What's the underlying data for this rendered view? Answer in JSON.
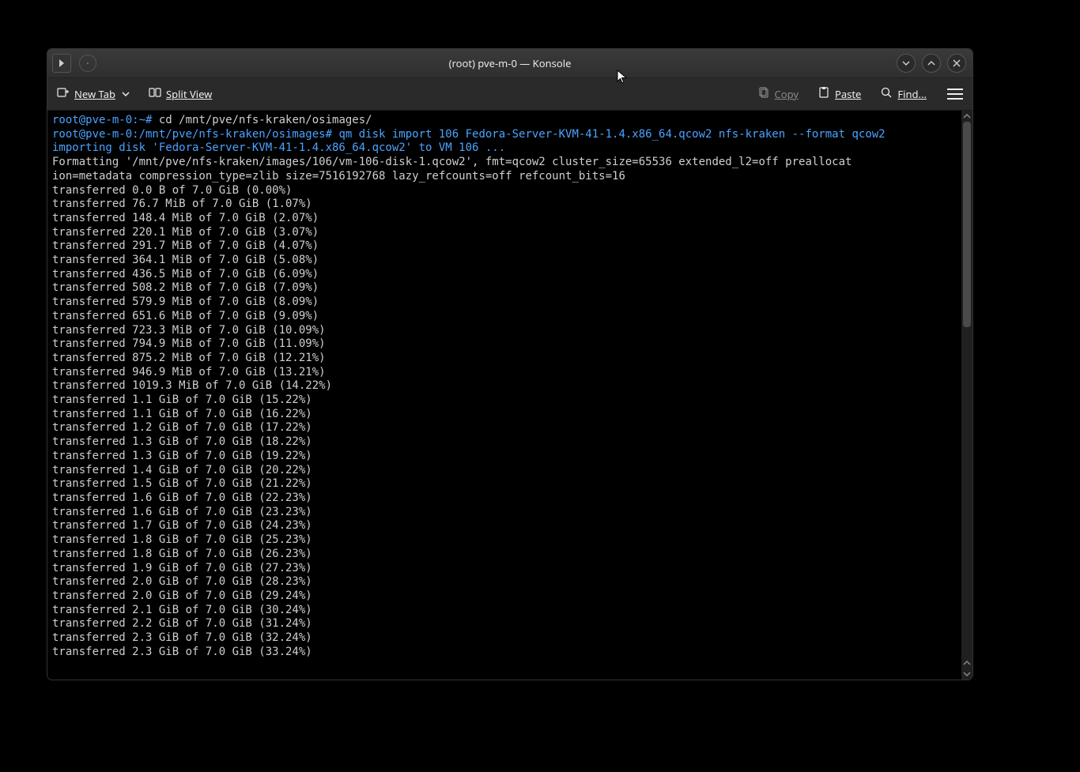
{
  "window": {
    "title": "(root) pve-m-0 — Konsole"
  },
  "toolbar": {
    "new_tab": "New Tab",
    "split_view": "Split View",
    "copy": "Copy",
    "paste": "Paste",
    "find": "Find..."
  },
  "prompt1": {
    "user_host": "root@pve-m-0",
    "path": "~",
    "cmd": "cd /mnt/pve/nfs-kraken/osimages/"
  },
  "prompt2": {
    "user_host": "root@pve-m-0",
    "path": "/mnt/pve/nfs-kraken/osimages",
    "cmd": "qm disk import 106 Fedora-Server-KVM-41-1.4.x86_64.qcow2 nfs-kraken --format qcow2"
  },
  "import_line": "importing disk 'Fedora-Server-KVM-41-1.4.x86_64.qcow2' to VM 106 ...",
  "format_line_a": "Formatting '/mnt/pve/nfs-kraken/images/106/vm-106-disk-1.qcow2', fmt=qcow2 cluster_size=65536 extended_l2=off preallocat",
  "format_line_b": "ion=metadata compression_type=zlib size=7516192768 lazy_refcounts=off refcount_bits=16",
  "transfers": [
    "transferred 0.0 B of 7.0 GiB (0.00%)",
    "transferred 76.7 MiB of 7.0 GiB (1.07%)",
    "transferred 148.4 MiB of 7.0 GiB (2.07%)",
    "transferred 220.1 MiB of 7.0 GiB (3.07%)",
    "transferred 291.7 MiB of 7.0 GiB (4.07%)",
    "transferred 364.1 MiB of 7.0 GiB (5.08%)",
    "transferred 436.5 MiB of 7.0 GiB (6.09%)",
    "transferred 508.2 MiB of 7.0 GiB (7.09%)",
    "transferred 579.9 MiB of 7.0 GiB (8.09%)",
    "transferred 651.6 MiB of 7.0 GiB (9.09%)",
    "transferred 723.3 MiB of 7.0 GiB (10.09%)",
    "transferred 794.9 MiB of 7.0 GiB (11.09%)",
    "transferred 875.2 MiB of 7.0 GiB (12.21%)",
    "transferred 946.9 MiB of 7.0 GiB (13.21%)",
    "transferred 1019.3 MiB of 7.0 GiB (14.22%)",
    "transferred 1.1 GiB of 7.0 GiB (15.22%)",
    "transferred 1.1 GiB of 7.0 GiB (16.22%)",
    "transferred 1.2 GiB of 7.0 GiB (17.22%)",
    "transferred 1.3 GiB of 7.0 GiB (18.22%)",
    "transferred 1.3 GiB of 7.0 GiB (19.22%)",
    "transferred 1.4 GiB of 7.0 GiB (20.22%)",
    "transferred 1.5 GiB of 7.0 GiB (21.22%)",
    "transferred 1.6 GiB of 7.0 GiB (22.23%)",
    "transferred 1.6 GiB of 7.0 GiB (23.23%)",
    "transferred 1.7 GiB of 7.0 GiB (24.23%)",
    "transferred 1.8 GiB of 7.0 GiB (25.23%)",
    "transferred 1.8 GiB of 7.0 GiB (26.23%)",
    "transferred 1.9 GiB of 7.0 GiB (27.23%)",
    "transferred 2.0 GiB of 7.0 GiB (28.23%)",
    "transferred 2.0 GiB of 7.0 GiB (29.24%)",
    "transferred 2.1 GiB of 7.0 GiB (30.24%)",
    "transferred 2.2 GiB of 7.0 GiB (31.24%)",
    "transferred 2.3 GiB of 7.0 GiB (32.24%)",
    "transferred 2.3 GiB of 7.0 GiB (33.24%)"
  ]
}
